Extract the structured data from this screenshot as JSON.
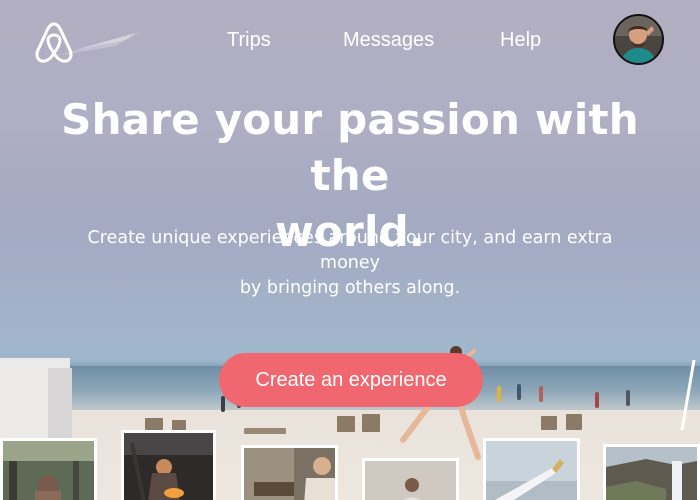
{
  "nav": {
    "logo_name": "airbnb-logo",
    "items": [
      {
        "label": "Trips"
      },
      {
        "label": "Messages"
      },
      {
        "label": "Help"
      }
    ],
    "avatar_icon": "user-avatar"
  },
  "hero": {
    "title_line1": "Share your passion with the",
    "title_line2": "world.",
    "subtitle_line1": "Create unique experiences around your city, and earn extra",
    "subtitle_line2": "money",
    "subtitle_line3": "by bringing others along.",
    "cta_label": "Create an experience"
  },
  "colors": {
    "brand": "#f06770",
    "text": "#ffffff"
  },
  "gallery": [
    {
      "name": "photo-forest"
    },
    {
      "name": "photo-campfire"
    },
    {
      "name": "photo-workshop"
    },
    {
      "name": "photo-portrait"
    },
    {
      "name": "photo-airplane-wing"
    },
    {
      "name": "photo-waterfall"
    }
  ]
}
